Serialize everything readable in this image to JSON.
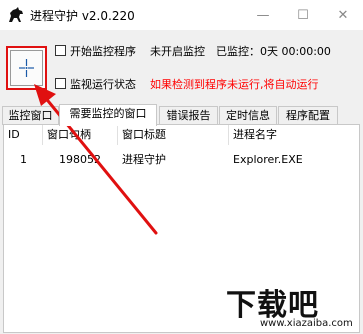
{
  "window": {
    "title": "进程守护 v2.0.220",
    "icon": "horse-logo-icon",
    "controls": {
      "minimize": "—",
      "maximize": "☐",
      "close": "✕"
    }
  },
  "controls": {
    "start_monitor_label": "开始监控程序",
    "status_text": "未开启监控",
    "monitored_label": "已监控：0天 00:00:00",
    "monitor_running_label": "监视运行状态",
    "hint_text": "如果检测到程序未运行,将自动运行"
  },
  "tabs": [
    "监控窗口",
    "需要监控的窗口",
    "错误报告",
    "定时信息",
    "程序配置"
  ],
  "active_tab": 1,
  "table": {
    "columns": [
      "ID",
      "窗口句柄",
      "窗口标题",
      "进程名字"
    ],
    "rows": [
      {
        "id": "1",
        "handle": "198052",
        "title": "进程守护",
        "process": "Explorer.EXE"
      }
    ]
  },
  "watermark": {
    "text": "下载吧",
    "url": "www.xiazaiba.com"
  },
  "colors": {
    "annotation": "#e01010",
    "hint": "#ff0000"
  }
}
